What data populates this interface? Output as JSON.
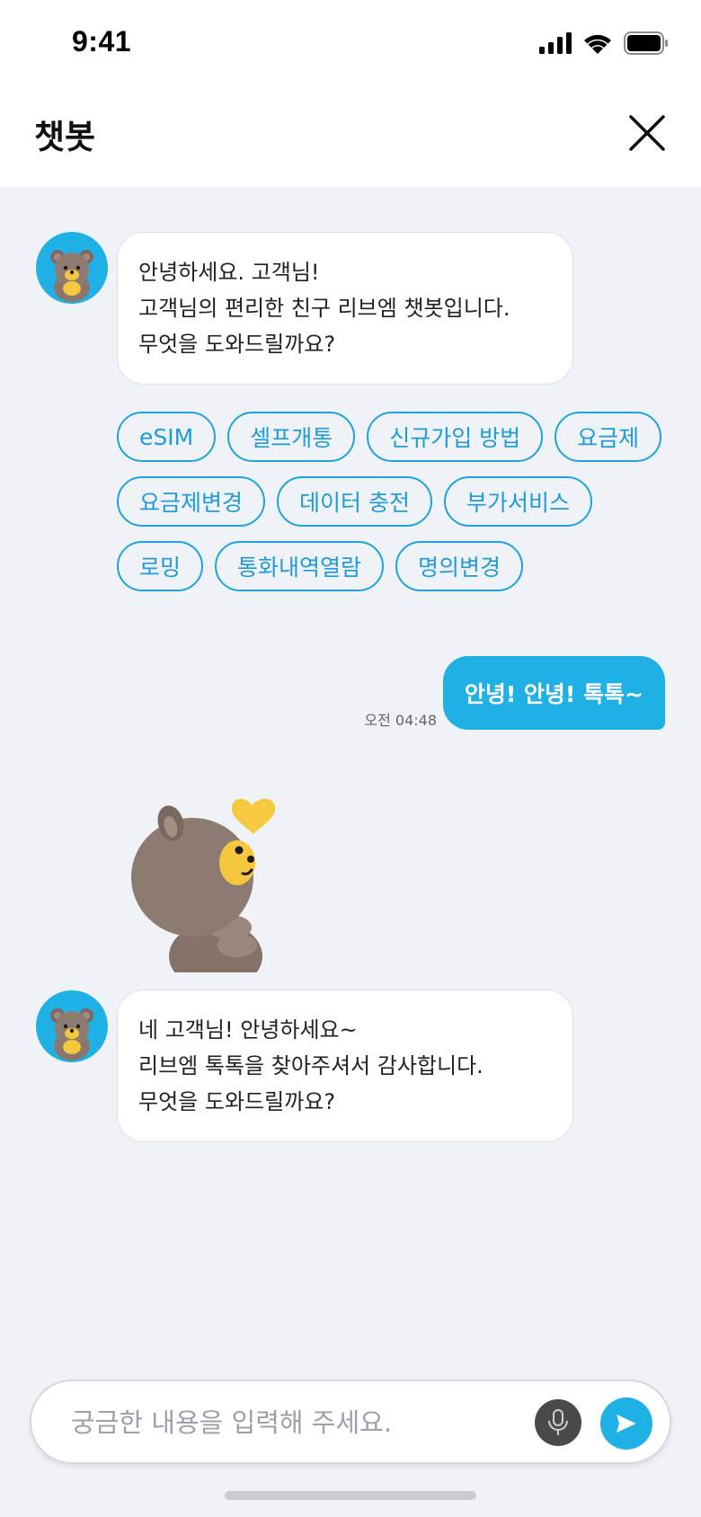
{
  "status_bar": {
    "time": "9:41"
  },
  "header": {
    "title": "챗봇"
  },
  "messages": {
    "bot_greeting": {
      "lines": [
        "안녕하세요. 고객님!",
        "고객님의 편리한 친구 리브엠 챗봇입니다.",
        "무엇을 도와드릴까요?"
      ]
    },
    "quick_replies": {
      "row1": [
        "eSIM",
        "셀프개통",
        "신규가입 방법",
        "요금제"
      ],
      "row2": [
        "요금제변경",
        "데이터 충전",
        "부가서비스"
      ],
      "row3": [
        "로밍",
        "통화내역열람",
        "명의변경"
      ]
    },
    "user_message": {
      "text": "안녕! 안녕! 톡톡~",
      "time": "오전 04:48"
    },
    "bot_reply": {
      "lines": [
        "네 고객님! 안녕하세요~",
        "리브엠 톡톡을 찾아주셔서 감사합니다.",
        "무엇을 도와드릴까요?"
      ]
    }
  },
  "input": {
    "placeholder": "궁금한 내용을 입력해 주세요.",
    "value": ""
  },
  "colors": {
    "accent": "#1fb0e6",
    "background": "#eff2f6",
    "chip_border": "#1fa3df",
    "mic": "#4a4a4a"
  },
  "icons": {
    "close": "close-icon",
    "mic": "microphone-icon",
    "send": "send-icon",
    "avatar": "bear-avatar",
    "signal": "cellular-signal-icon",
    "wifi": "wifi-icon",
    "battery": "battery-icon",
    "sticker": "bear-heart-sticker"
  }
}
